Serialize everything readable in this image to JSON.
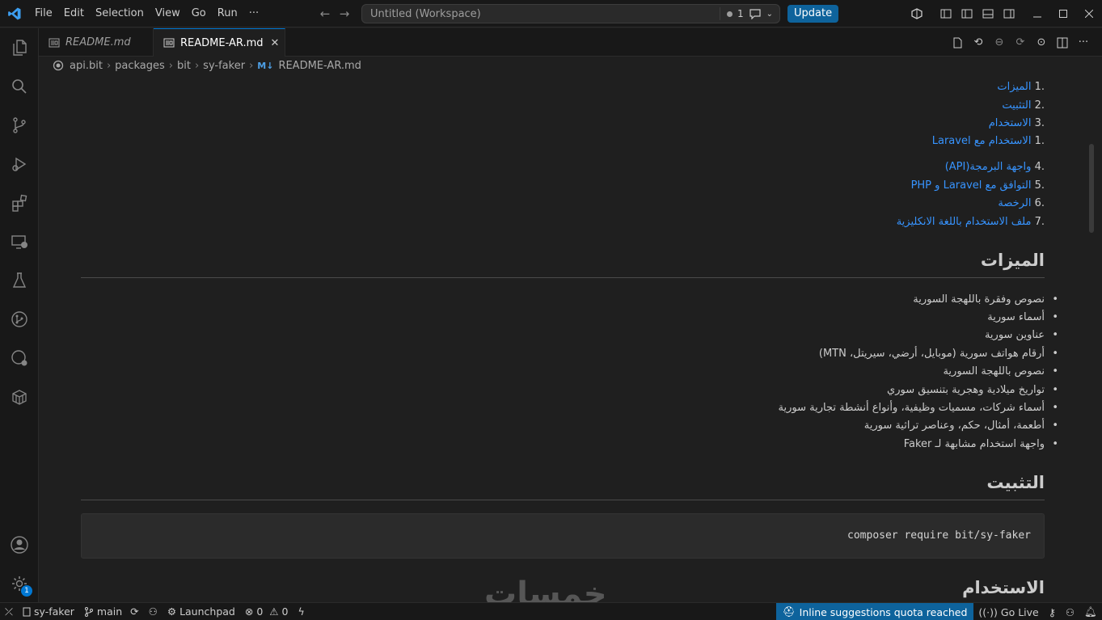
{
  "menu": [
    "File",
    "Edit",
    "Selection",
    "View",
    "Go",
    "Run",
    "···"
  ],
  "command_center": {
    "title": "Untitled (Workspace)",
    "problems_count": "1"
  },
  "update_label": "Update",
  "tabs": [
    {
      "label": "README.md",
      "active": false
    },
    {
      "label": "README-AR.md",
      "active": true
    }
  ],
  "breadcrumb": [
    "api.bit",
    "packages",
    "bit",
    "sy-faker",
    "README-AR.md"
  ],
  "breadcrumb_md_icon": "M↓",
  "toc": [
    {
      "num": ".1",
      "text": "الميزات"
    },
    {
      "num": ".2",
      "text": "التثبيت"
    },
    {
      "num": ".3",
      "text": "الاستخدام"
    },
    {
      "num": ".1",
      "text": "الاستخدام مع Laravel"
    },
    {
      "num": ".4",
      "text": "واجهة البرمجة(API)"
    },
    {
      "num": ".5",
      "text": "التوافق مع Laravel و PHP"
    },
    {
      "num": ".6",
      "text": "الرخصة"
    },
    {
      "num": ".7",
      "text": "ملف الاستخدام باللغة الانكليزية"
    }
  ],
  "features_heading": "الميزات",
  "features": [
    "نصوص وفقرة باللهجة السورية",
    "أسماء سورية",
    "عناوين سورية",
    "أرقام هواتف سورية (موبايل، أرضي، سيريتل، MTN)",
    "نصوص باللهجة السورية",
    "تواريخ ميلادية وهجرية بتنسيق سوري",
    "أسماء شركات، مسميات وظيفية، وأنواع أنشطة تجارية سورية",
    "أطعمة، أمثال، حكم، وعناصر تراثية سورية",
    "واجهة استخدام مشابهة لـ Faker"
  ],
  "install_heading": "التثبيت",
  "install_code": "composer require bit/sy-faker",
  "usage_heading": "الاستخدام",
  "watermark": "خمسات",
  "account_badge": "1",
  "status": {
    "remote": "",
    "folder": "sy-faker",
    "branch": "main",
    "launchpad": "Launchpad",
    "errors": "0",
    "warnings": "0",
    "quota": "Inline suggestions quota reached",
    "go_live": "Go Live"
  },
  "colors": {
    "accent": "#0078d4",
    "link": "#3794ff",
    "update": "#0e639c"
  }
}
